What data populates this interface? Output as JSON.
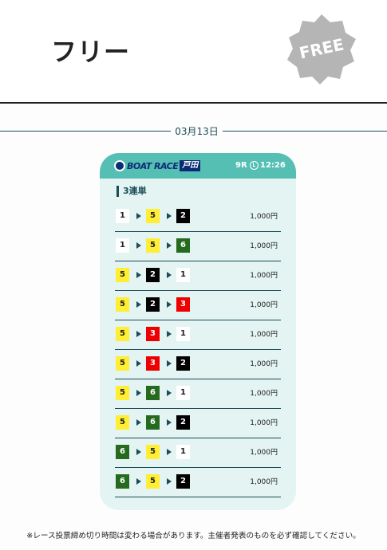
{
  "header": {
    "title": "フリー",
    "badge": "FREE",
    "badge_color": "#b5b5b5"
  },
  "date": "03月13日",
  "card": {
    "logo_text": "BOAT RACE",
    "venue": "戸田",
    "race": "9R",
    "time": "12:26",
    "bet_type": "3連単",
    "bets": [
      {
        "first": "1",
        "second": "5",
        "third": "2",
        "amount": "1,000円"
      },
      {
        "first": "1",
        "second": "5",
        "third": "6",
        "amount": "1,000円"
      },
      {
        "first": "5",
        "second": "2",
        "third": "1",
        "amount": "1,000円"
      },
      {
        "first": "5",
        "second": "2",
        "third": "3",
        "amount": "1,000円"
      },
      {
        "first": "5",
        "second": "3",
        "third": "1",
        "amount": "1,000円"
      },
      {
        "first": "5",
        "second": "3",
        "third": "2",
        "amount": "1,000円"
      },
      {
        "first": "5",
        "second": "6",
        "third": "1",
        "amount": "1,000円"
      },
      {
        "first": "5",
        "second": "6",
        "third": "2",
        "amount": "1,000円"
      },
      {
        "first": "6",
        "second": "5",
        "third": "1",
        "amount": "1,000円"
      },
      {
        "first": "6",
        "second": "5",
        "third": "2",
        "amount": "1,000円"
      }
    ]
  },
  "note": "※レース投票締め切り時間は変わる場合があります。主催者発表のものを必ず確認してください。",
  "colors": {
    "accent": "#56bfb4",
    "dark": "#1b4d59",
    "card_bg": "#e3f4f2",
    "boat_1": "#ffffff",
    "boat_2": "#000000",
    "boat_3": "#ee0000",
    "boat_5": "#ffee33",
    "boat_6": "#256a1e"
  }
}
